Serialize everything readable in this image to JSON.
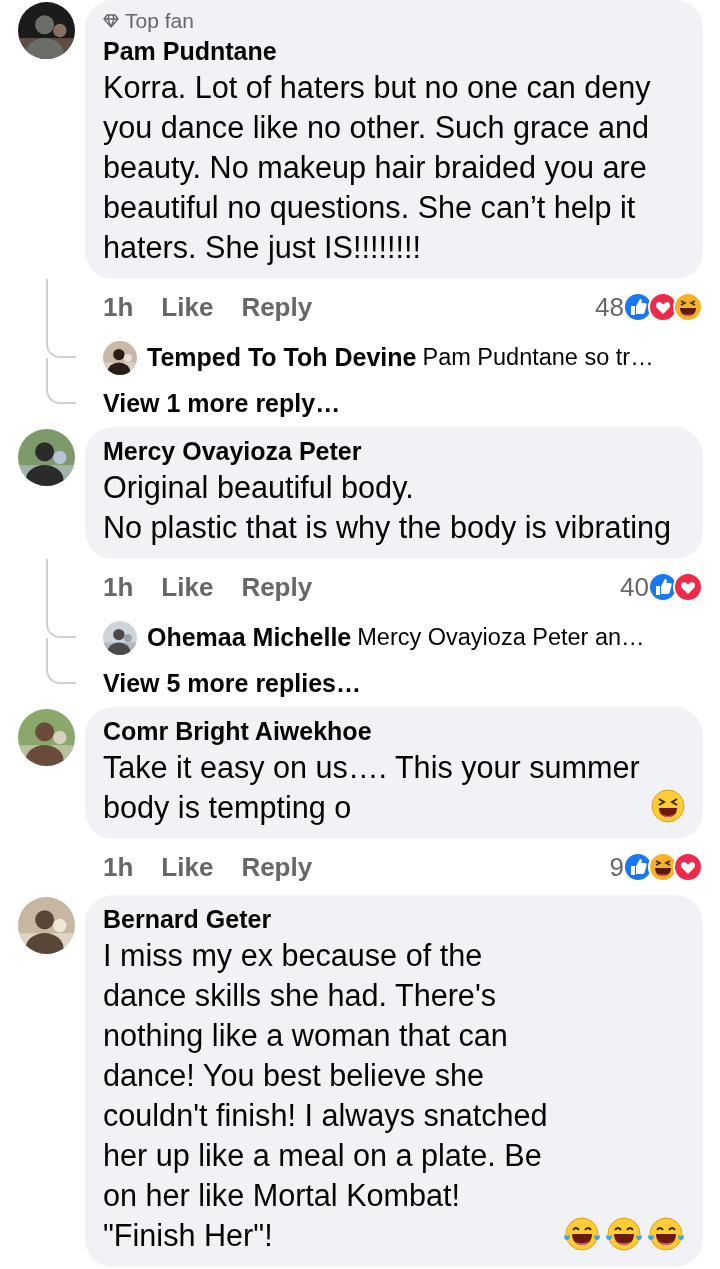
{
  "comments": [
    {
      "avatar": {
        "kind": "picture"
      },
      "badge": "Top fan",
      "author": "Pam Pudntane",
      "text": "Korra. Lot of haters but no one can deny you dance like no other. Such grace and beauty. No makeup hair braided you are beautiful no questions. She can’t help it haters. She just IS!!!!!!!!",
      "time": "1h",
      "actions": [
        "Like",
        "Reply"
      ],
      "reaction_count": "48",
      "reactions": [
        {
          "kind": "like"
        },
        {
          "kind": "love"
        },
        {
          "kind": "haha"
        }
      ],
      "reply_preview": {
        "author": "Temped To Toh Devine",
        "text": "Pam Pudntane so tr…"
      },
      "more_replies": "View 1 more reply…"
    },
    {
      "avatar": {
        "kind": "picture"
      },
      "author": "Mercy Ovayioza Peter",
      "text": "Original beautiful body.\nNo plastic that is why the body is vibrating",
      "time": "1h",
      "actions": [
        "Like",
        "Reply"
      ],
      "reaction_count": "40",
      "reactions": [
        {
          "kind": "like"
        },
        {
          "kind": "love"
        }
      ],
      "reply_preview": {
        "author": "Ohemaa Michelle",
        "text": "Mercy Ovayioza Peter an…"
      },
      "more_replies": "View 5 more replies…"
    },
    {
      "avatar": {
        "kind": "picture"
      },
      "author": "Comr Bright Aiwekhoe",
      "text": "Take it easy on us…. This your summer body is tempting o",
      "emojis": [
        {
          "kind": "squint"
        }
      ],
      "time": "1h",
      "actions": [
        "Like",
        "Reply"
      ],
      "reaction_count": "9",
      "reactions": [
        {
          "kind": "like"
        },
        {
          "kind": "haha"
        },
        {
          "kind": "love"
        }
      ]
    },
    {
      "avatar": {
        "kind": "picture"
      },
      "author": "Bernard Geter",
      "text": "I miss my ex because of the dance skills she had. There's nothing like a woman that can dance! You best believe she couldn't finish! I always snatched her up like a meal on a plate. Be on her like Mortal Kombat! \"Finish Her\"!",
      "emojis": [
        {
          "kind": "tears"
        },
        {
          "kind": "tears"
        },
        {
          "kind": "tears"
        }
      ]
    }
  ]
}
